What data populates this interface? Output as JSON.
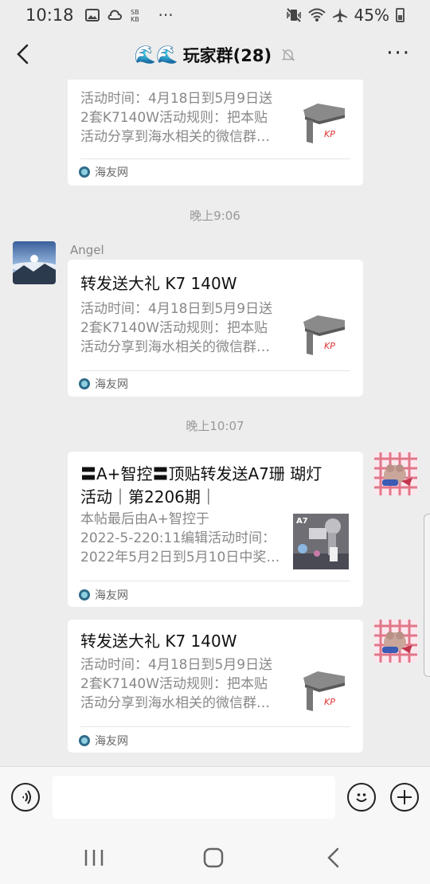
{
  "status_bar": {
    "time": "10:18",
    "more": "···",
    "battery": "45%"
  },
  "header": {
    "waves": "🌊🌊",
    "title": "玩家群(28)",
    "more": "···"
  },
  "messages": {
    "card1": {
      "desc": [
        "活动时间：4月18日到5月9日送",
        "2套K7140W活动规则：把本贴",
        "活动分享到海水相关的微信群…"
      ],
      "source": "海友网"
    },
    "time1": "晚上9:06",
    "sender2": "Angel",
    "card2": {
      "title": "转发送大礼 K7 140W",
      "desc": [
        "活动时间：4月18日到5月9日送",
        "2套K7140W活动规则：把本贴",
        "活动分享到海水相关的微信群…"
      ],
      "source": "海友网"
    },
    "time2": "晚上10:07",
    "card3": {
      "title": [
        "〓A+智控〓顶贴转发送A7珊 瑚灯",
        "活动｜第2206期｜"
      ],
      "desc": [
        "本帖最后由A+智控于",
        "2022-5-220:11编辑活动时间：",
        "2022年5月2日到5月10日中奖…"
      ],
      "thumb_label": "A7",
      "source": "海友网"
    },
    "card4": {
      "title": "转发送大礼 K7 140W",
      "desc": [
        "活动时间：4月18日到5月9日送",
        "2套K7140W活动规则：把本贴",
        "活动分享到海水相关的微信群…"
      ],
      "source": "海友网"
    },
    "product_logo": "KP"
  },
  "input_bar": {
    "placeholder": ""
  }
}
